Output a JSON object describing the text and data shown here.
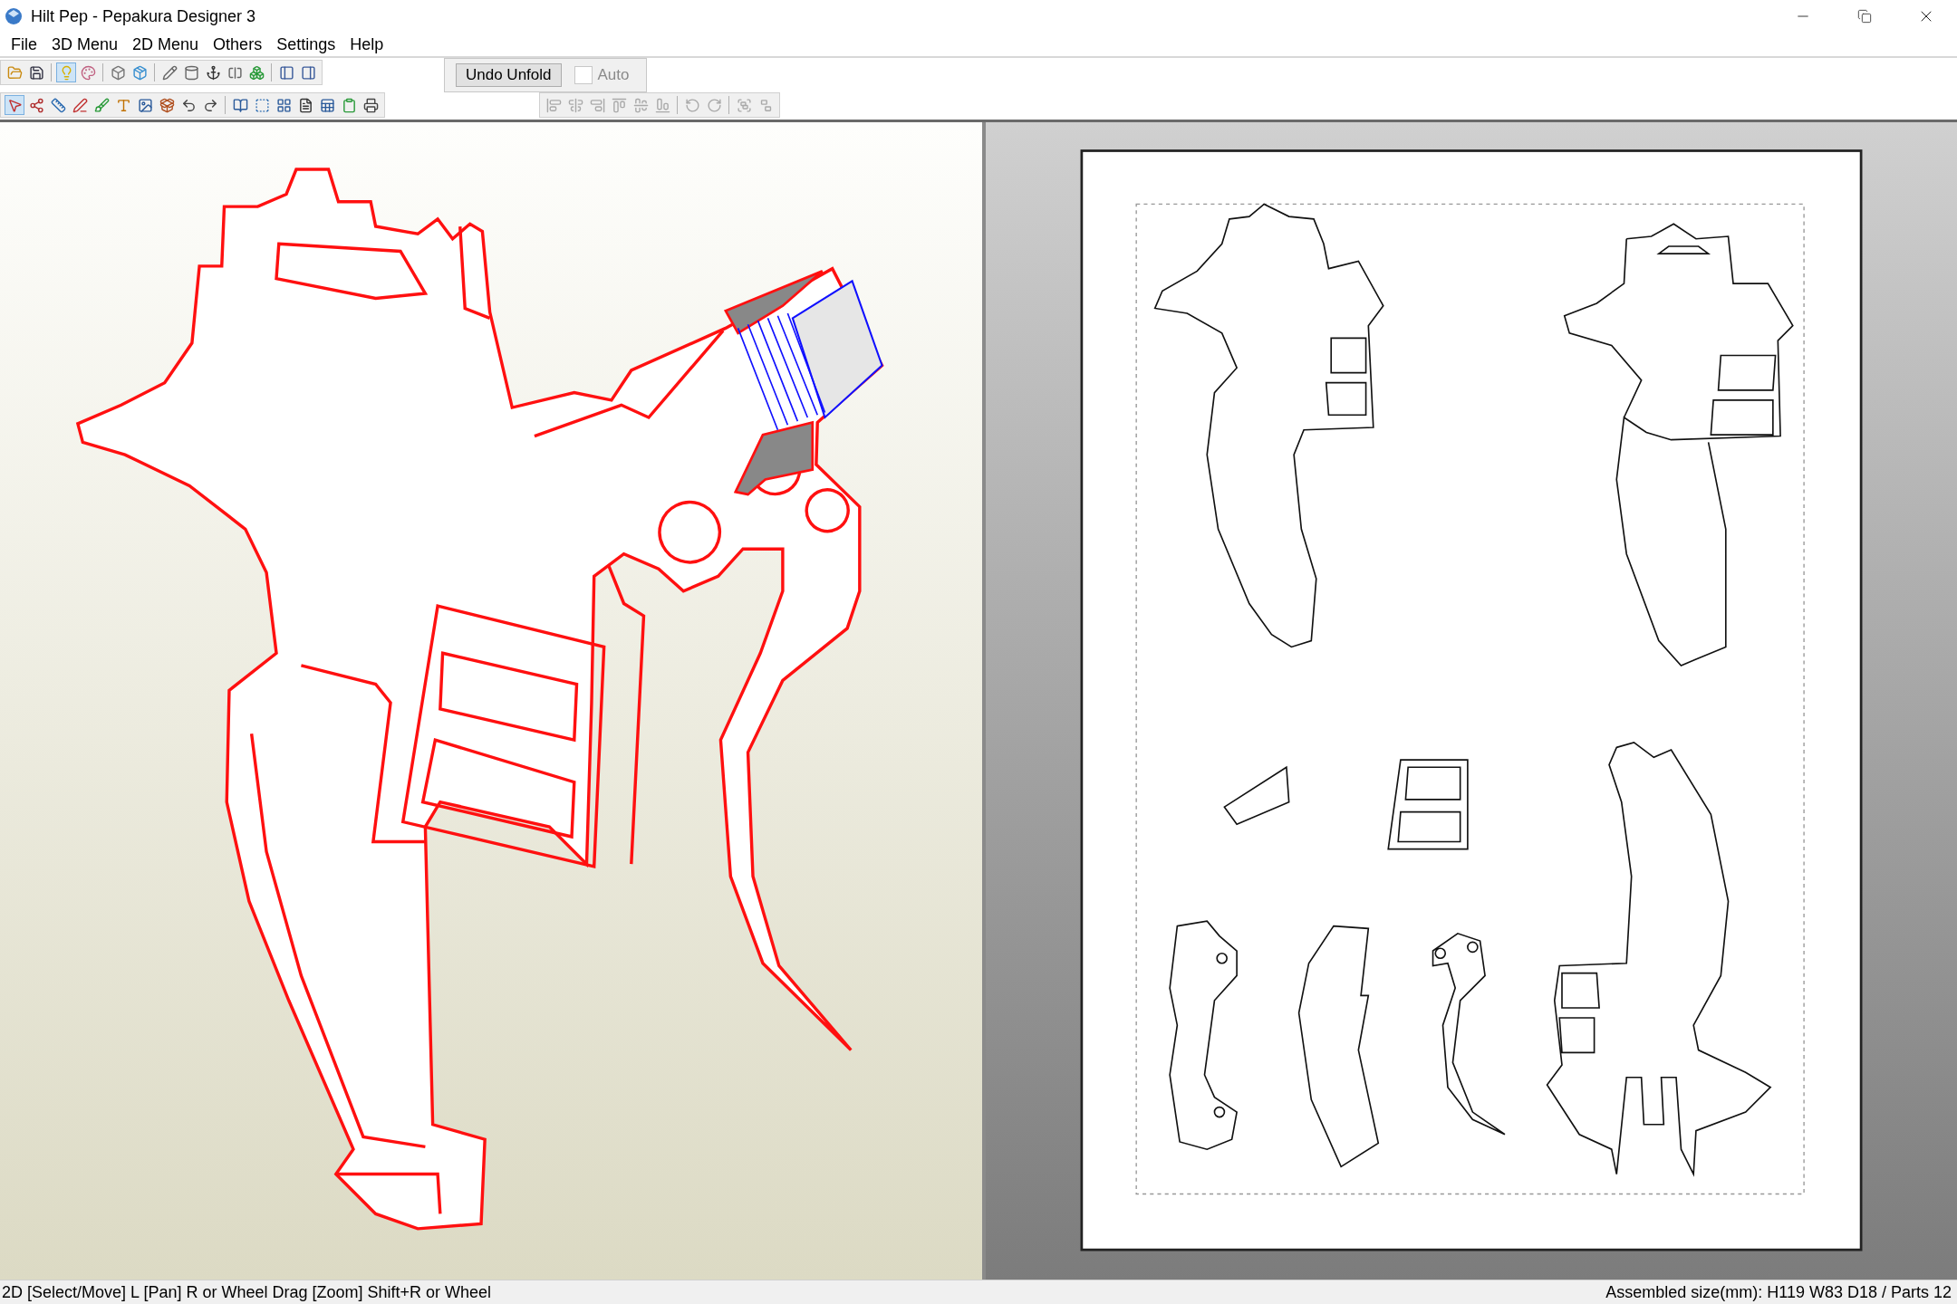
{
  "window": {
    "title": "Hilt Pep - Pepakura Designer 3"
  },
  "menu": [
    "File",
    "3D Menu",
    "2D Menu",
    "Others",
    "Settings",
    "Help"
  ],
  "toolbar_main": [
    {
      "selected": false
    },
    {
      "selected": false
    },
    {
      "selected": true
    },
    {
      "selected": false
    },
    {
      "selected": false
    },
    {
      "selected": false
    },
    {
      "selected": false
    },
    {
      "selected": false
    },
    {
      "selected": false
    },
    {
      "selected": false
    },
    {
      "selected": false
    },
    {
      "selected": false
    },
    {
      "selected": false
    }
  ],
  "undo_button": {
    "label": "Undo Unfold"
  },
  "auto_checkbox": {
    "label": "Auto",
    "checked": false,
    "disabled": true
  },
  "toolbar_2d": [
    {
      "selected": true
    },
    {
      "selected": false
    },
    {
      "selected": false
    },
    {
      "selected": false
    },
    {
      "selected": false
    },
    {
      "selected": false
    },
    {
      "selected": false
    },
    {
      "selected": false
    },
    {
      "selected": false
    },
    {
      "selected": false
    },
    {
      "selected": false
    },
    {
      "selected": false
    },
    {
      "selected": false
    },
    {
      "selected": false
    },
    {
      "selected": false
    },
    {
      "selected": false
    },
    {
      "selected": false
    }
  ],
  "toolbar_align": [
    {
      "disabled": true
    },
    {
      "disabled": true
    },
    {
      "disabled": true
    },
    {
      "disabled": true
    },
    {
      "disabled": true
    },
    {
      "disabled": true
    },
    {
      "disabled": true
    },
    {
      "disabled": true
    },
    {
      "disabled": true
    },
    {
      "disabled": true
    }
  ],
  "status_bar": {
    "left": "2D [Select/Move] L [Pan] R or Wheel Drag [Zoom] Shift+R or Wheel",
    "right": "Assembled size(mm): H119 W83 D18 / Parts 12"
  }
}
